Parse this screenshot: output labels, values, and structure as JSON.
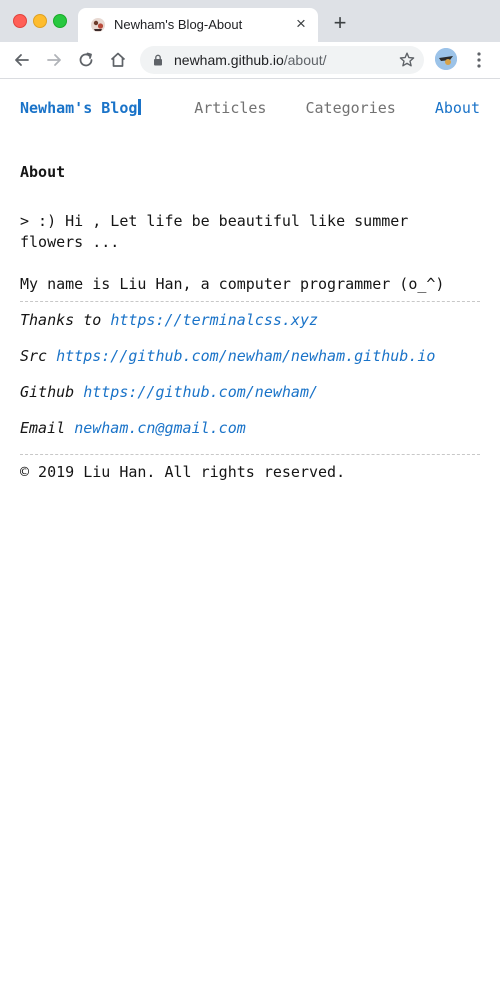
{
  "browser": {
    "tab_title": "Newham's Blog-About",
    "url_host": "newham.github.io",
    "url_path": "/about/"
  },
  "site": {
    "logo": "Newham's Blog",
    "nav": [
      "Articles",
      "Categories",
      "About"
    ],
    "active_nav": "About",
    "accent_color": "#1a73c8"
  },
  "about": {
    "heading": "About",
    "quote": "> :) Hi , Let life be beautiful like summer flowers ...",
    "intro": "My name is Liu Han, a computer programmer (o_^)",
    "links": [
      {
        "label": "Thanks to",
        "url": "https://terminalcss.xyz"
      },
      {
        "label": "Src",
        "url": "https://github.com/newham/newham.github.io"
      },
      {
        "label": "Github",
        "url": "https://github.com/newham/"
      },
      {
        "label": "Email",
        "url": "newham.cn@gmail.com"
      }
    ],
    "copyright": "© 2019 Liu Han. All rights reserved."
  }
}
